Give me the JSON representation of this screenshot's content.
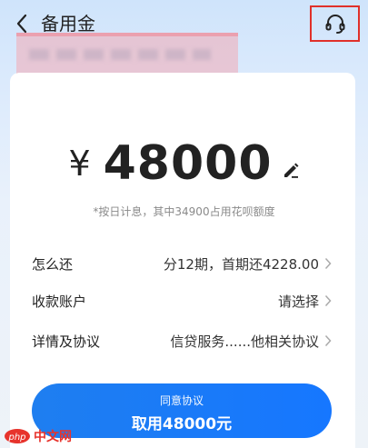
{
  "header": {
    "title": "备用金",
    "back_icon": "chevron-left-icon",
    "service_icon": "headset-icon",
    "highlight_color": "#e0302a"
  },
  "loan": {
    "currency": "¥",
    "amount": "48000",
    "edit_icon": "pencil-icon",
    "note": "*按日计息，其中34900占用花呗额度"
  },
  "rows": [
    {
      "label": "怎么还",
      "value": "分12期，首期还4228.00"
    },
    {
      "label": "收款账户",
      "value": "请选择"
    },
    {
      "label": "详情及协议",
      "value": "信贷服务......他相关协议"
    }
  ],
  "cta": {
    "sub_label": "同意协议",
    "main_label": "取用48000元",
    "color": "#1677ff"
  },
  "watermark": {
    "text": "中文网",
    "logo": "php"
  }
}
